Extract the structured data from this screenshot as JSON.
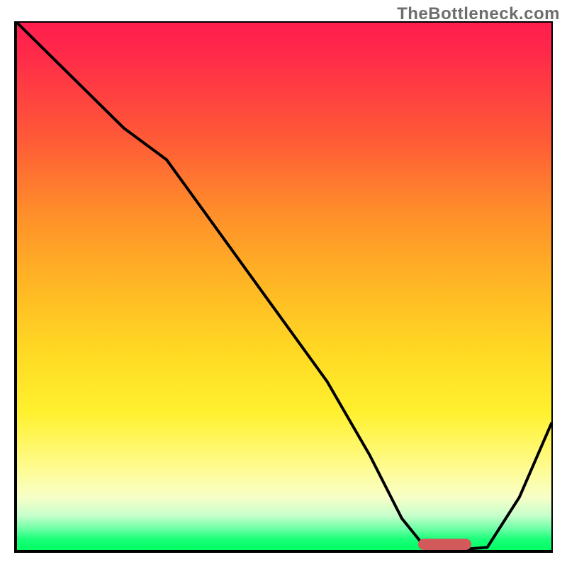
{
  "watermark": "TheBottleneck.com",
  "colors": {
    "top": "#ff1e4f",
    "mid": "#ffd823",
    "bottom": "#04ff63",
    "curve": "#000000",
    "marker": "#d35a5a"
  },
  "chart_data": {
    "type": "line",
    "title": "",
    "xlabel": "",
    "ylabel": "",
    "xlim": [
      0,
      100
    ],
    "ylim": [
      0,
      100
    ],
    "series": [
      {
        "name": "bottleneck-curve",
        "x": [
          0,
          10,
          20,
          28,
          38,
          48,
          58,
          66,
          72,
          76,
          82,
          88,
          94,
          100
        ],
        "y": [
          100,
          90,
          80,
          74,
          60,
          46,
          32,
          18,
          6,
          1,
          0,
          0.5,
          10,
          24
        ]
      }
    ],
    "marker": {
      "x_start": 75,
      "x_end": 85,
      "y": 0
    },
    "background_gradient": {
      "direction": "vertical",
      "stops": [
        {
          "pct": 0,
          "color": "#ff1e4f"
        },
        {
          "pct": 22,
          "color": "#ff5a37"
        },
        {
          "pct": 48,
          "color": "#ffb225"
        },
        {
          "pct": 74,
          "color": "#fff12e"
        },
        {
          "pct": 90,
          "color": "#f8ffc8"
        },
        {
          "pct": 96,
          "color": "#6cffa5"
        },
        {
          "pct": 100,
          "color": "#04ff63"
        }
      ]
    }
  }
}
